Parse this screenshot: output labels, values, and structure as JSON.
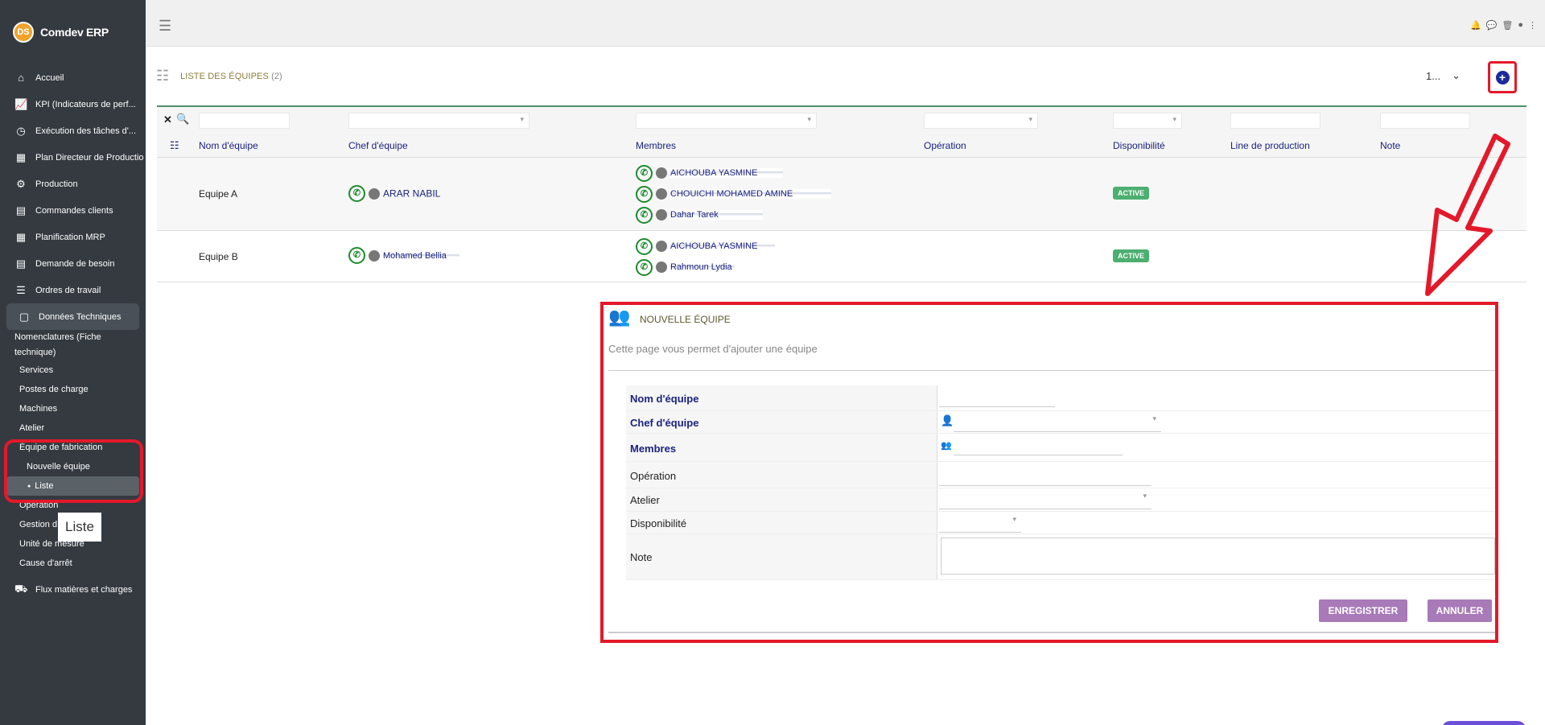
{
  "brand": {
    "logo_text": "DS",
    "name": "Comdev ERP"
  },
  "nav": [
    {
      "label": "Accueil",
      "icon": "home-icon",
      "glyph": "⌂"
    },
    {
      "label": "KPI (Indicateurs de perf...",
      "icon": "chart-line-icon",
      "glyph": "📈"
    },
    {
      "label": "Exécution des tâches d'...",
      "icon": "clock-icon",
      "glyph": "◷"
    },
    {
      "label": "Plan Directeur de Productio",
      "icon": "calendar-icon",
      "glyph": "▦"
    },
    {
      "label": "Production",
      "icon": "gears-icon",
      "glyph": "⚙"
    },
    {
      "label": "Commandes clients",
      "icon": "document-icon",
      "glyph": "▤"
    },
    {
      "label": "Planification MRP",
      "icon": "calendar-icon",
      "glyph": "▦"
    },
    {
      "label": "Demande de besoin",
      "icon": "document-icon",
      "glyph": "▤"
    },
    {
      "label": "Ordres de travail",
      "icon": "tasks-icon",
      "glyph": "☰"
    },
    {
      "label": "Données Techniques",
      "icon": "document-icon",
      "glyph": "▢"
    }
  ],
  "sub_nav": {
    "nomenclatures": "Nomenclatures (Fiche technique)",
    "services": "Services",
    "postes": "Postes de charge",
    "machines": "Machines",
    "atelier": "Atelier",
    "equipe": "Équipe de fabrication",
    "nouvelle": "Nouvelle équipe",
    "liste": "Liste",
    "operation": "Opération",
    "gestion": "Gestion d",
    "unite": "Unité de mesure",
    "cause": "Cause d'arrêt",
    "flux": "Flux matières et charges"
  },
  "tooltip": "Liste",
  "header": {
    "title": "LISTE DES ÉQUIPES",
    "count": "(2)",
    "page_size": "1..."
  },
  "columns": [
    "Nom d'équipe",
    "Chef d'équipe",
    "Membres",
    "Opération",
    "Disponibilité",
    "Line de production",
    "Note"
  ],
  "rows": [
    {
      "name": "Equipe A",
      "chef": "ARAR NABIL",
      "members": [
        "AICHOUBA YASMINE",
        "CHOUICHI MOHAMED AMINE",
        "Dahar Tarek"
      ],
      "status": "ACTIVE"
    },
    {
      "name": "Equipe B",
      "chef": "Mohamed Bellia",
      "members": [
        "AICHOUBA YASMINE",
        "Rahmoun Lydia"
      ],
      "status": "ACTIVE"
    }
  ],
  "form": {
    "title": "NOUVELLE ÉQUIPE",
    "subtitle": "Cette page vous permet d'ajouter une équipe",
    "labels": {
      "nom": "Nom d'équipe",
      "chef": "Chef d'équipe",
      "membres": "Membres",
      "operation": "Opération",
      "atelier": "Atelier",
      "disponibilite": "Disponibilité",
      "note": "Note"
    },
    "save": "ENREGISTRER",
    "cancel": "ANNULER"
  },
  "colors": {
    "sidebar": "#343a40",
    "accent_red": "#e3192a",
    "button": "#a87ab8",
    "badge": "#4caf70"
  }
}
